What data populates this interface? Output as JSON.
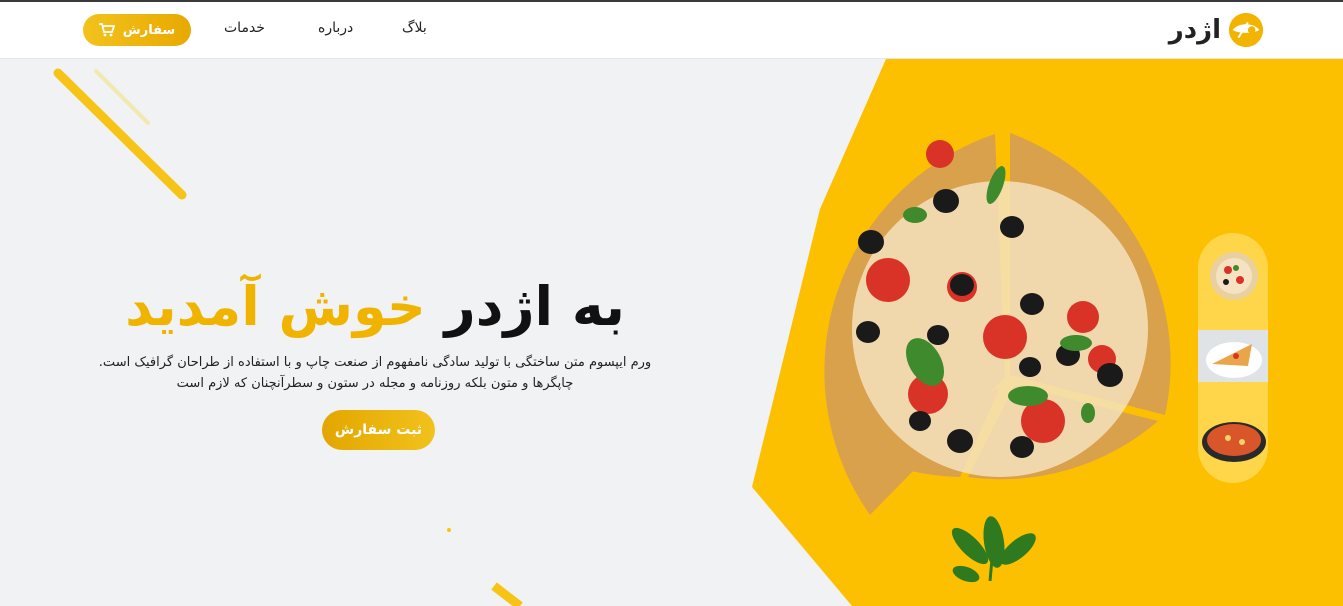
{
  "nav": {
    "brand_name": "اژدر",
    "links": [
      "بلاگ",
      "درباره",
      "خدمات"
    ],
    "order_button": "سفارش"
  },
  "hero": {
    "title_dark": "به اژدر",
    "title_accent": "خوش آمدید",
    "description_line1": "ورم ایپسوم متن ساختگی با تولید سادگی نامفهوم از صنعت چاپ و با استفاده از طراحان گرافیک است.",
    "description_line2": "چاپگرها و متون بلکه روزنامه و مجله در ستون و سطرآنچنان که لازم است",
    "cta_label": "ثبت سفارش"
  },
  "colors": {
    "accent": "#f0b400",
    "panel_yellow": "#fdc000",
    "background": "#f1f2f4",
    "text_dark": "#111111"
  },
  "icons": [
    "cart-icon",
    "logo-icon",
    "pizza-image",
    "basil-image"
  ]
}
